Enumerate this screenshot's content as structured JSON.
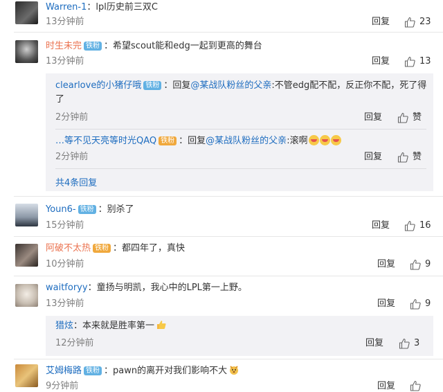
{
  "reply_label": "回复",
  "like_label": "赞",
  "comments": [
    {
      "user": "Warren-1",
      "text": "lpl历史前三双C",
      "time": "13分钟前",
      "likes": "23"
    },
    {
      "user": "时生未完",
      "badge": "铁粉",
      "text": "希望scout能和edg一起到更高的舞台",
      "time": "13分钟前",
      "likes": "13",
      "subs": [
        {
          "user": "clearlove的小猪仔哦",
          "badge": "铁粉",
          "reply_word": "回复",
          "at": "@某战队粉丝的父亲",
          "text": ":不管edg配不配，反正你不配，死了得了",
          "time": "2分钟前"
        },
        {
          "user": "…等不见天亮等时光QAQ",
          "badge": "铁粉",
          "reply_word": "回复",
          "at": "@某战队粉丝的父亲",
          "text": ":滚啊",
          "time": "2分钟前"
        }
      ],
      "more": "共4条回复"
    },
    {
      "user": "Youn6-",
      "badge": "铁粉",
      "text": "别杀了",
      "time": "15分钟前",
      "likes": "16"
    },
    {
      "user": "阿破不太热",
      "badge": "铁粉",
      "text": "都四年了，真快",
      "time": "10分钟前",
      "likes": "9"
    },
    {
      "user": "waitforyy",
      "text": "童扬与明凯，我心中的LPL第一上野。",
      "time": "13分钟前",
      "likes": "9",
      "subs": [
        {
          "user": "猎炫",
          "text": "本来就是胜率第一",
          "time": "12分钟前",
          "likes": "3"
        }
      ]
    },
    {
      "user": "艾姆梅路",
      "badge": "铁粉",
      "text": "pawn的离开对我们影响不大",
      "time": "9分钟前",
      "likes": ""
    }
  ]
}
